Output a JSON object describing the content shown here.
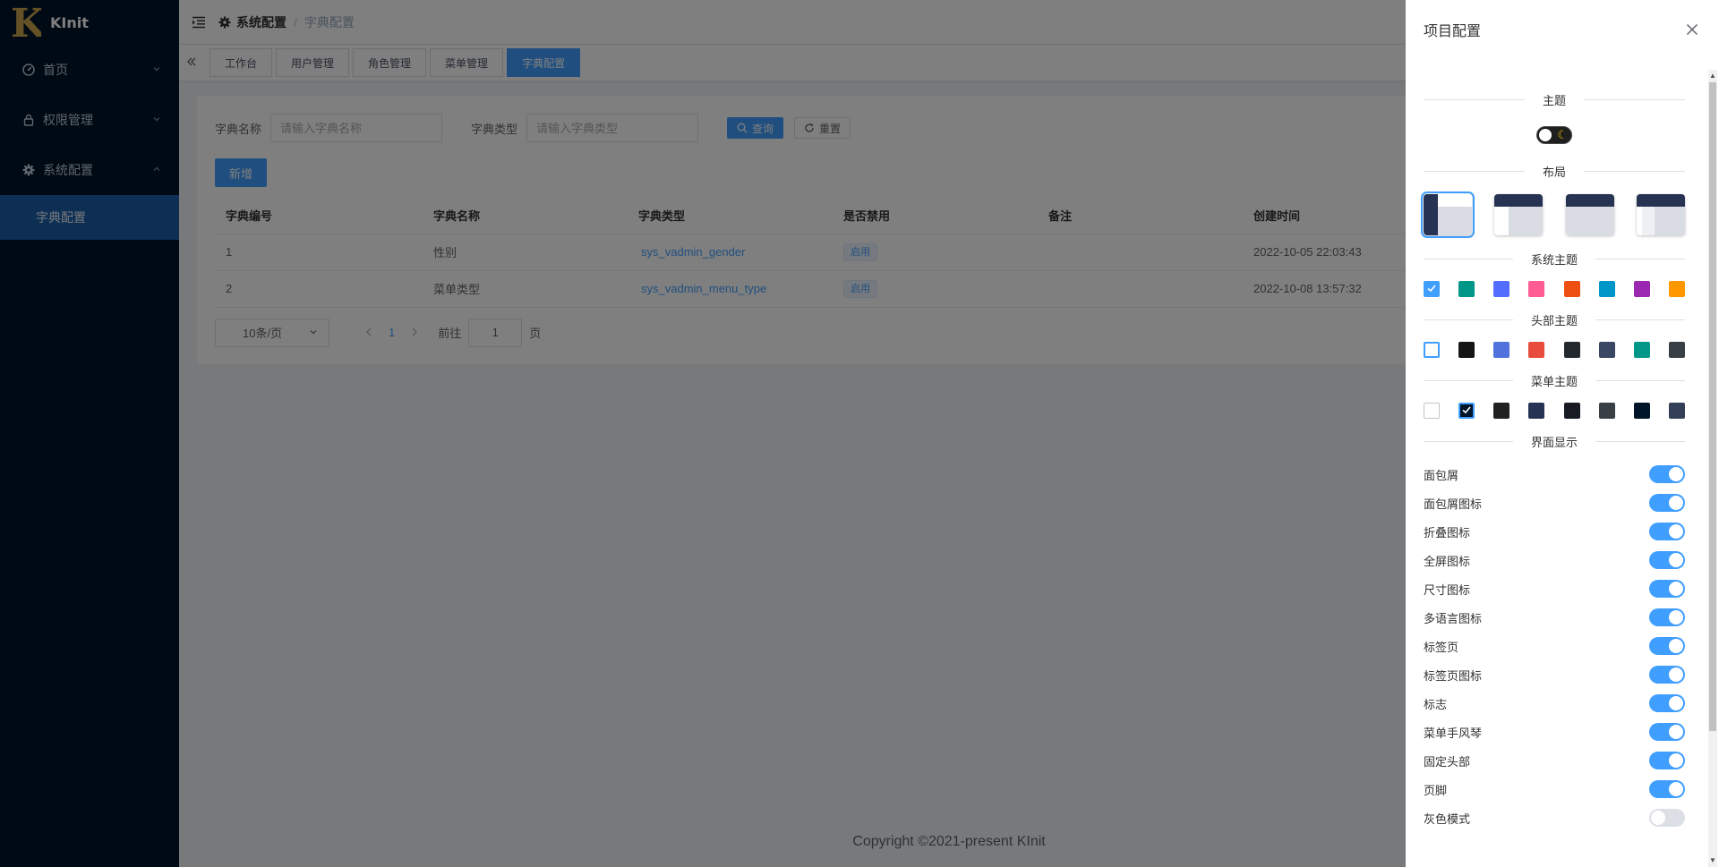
{
  "app": {
    "name": "KInit",
    "logo_letter": "K"
  },
  "sidebar": {
    "items": [
      {
        "label": "首页",
        "icon": "dashboard-icon"
      },
      {
        "label": "权限管理",
        "icon": "lock-icon"
      },
      {
        "label": "系统配置",
        "icon": "gear-icon",
        "expanded": true,
        "children": [
          {
            "label": "字典配置",
            "active": true
          }
        ]
      }
    ]
  },
  "header": {
    "breadcrumb": [
      "系统配置",
      "字典配置"
    ]
  },
  "tabs": [
    {
      "label": "工作台"
    },
    {
      "label": "用户管理"
    },
    {
      "label": "角色管理"
    },
    {
      "label": "菜单管理"
    },
    {
      "label": "字典配置",
      "active": true
    }
  ],
  "search": {
    "name_label": "字典名称",
    "name_placeholder": "请输入字典名称",
    "type_label": "字典类型",
    "type_placeholder": "请输入字典类型",
    "query_label": "查询",
    "reset_label": "重置",
    "add_label": "新增"
  },
  "table": {
    "columns": [
      "字典编号",
      "字典名称",
      "字典类型",
      "是否禁用",
      "备注",
      "创建时间"
    ],
    "rows": [
      {
        "id": "1",
        "name": "性别",
        "type": "sys_vadmin_gender",
        "status": "启用",
        "remark": "",
        "created": "2022-10-05 22:03:43"
      },
      {
        "id": "2",
        "name": "菜单类型",
        "type": "sys_vadmin_menu_type",
        "status": "启用",
        "remark": "",
        "created": "2022-10-08 13:57:32"
      }
    ]
  },
  "pagination": {
    "page_size": "10条/页",
    "current_page": "1",
    "goto_label": "前往",
    "goto_value": "1",
    "page_unit": "页"
  },
  "footer": {
    "copyright": "Copyright ©2021-present KInit"
  },
  "drawer": {
    "title": "项目配置",
    "sections": {
      "theme": "主题",
      "layout": "布局",
      "system_theme": "系统主题",
      "header_theme": "头部主题",
      "menu_theme": "菜单主题",
      "interface": "界面显示"
    },
    "system_colors": [
      "#409eff",
      "#009688",
      "#536dfe",
      "#ff5c93",
      "#ee4f12",
      "#0096c7",
      "#9c27b0",
      "#ff9800"
    ],
    "header_colors": [
      "#ffffff",
      "#151515",
      "#5172dc",
      "#e74c3c",
      "#24292e",
      "#394664",
      "#009688",
      "#383f45"
    ],
    "menu_colors": [
      "#ffffff",
      "#001529",
      "#212121",
      "#273352",
      "#191b24",
      "#383f45",
      "#001628",
      "#344058"
    ],
    "system_selected": 0,
    "header_selected": 0,
    "menu_selected": 1,
    "toggles": [
      {
        "label": "面包屑",
        "on": true
      },
      {
        "label": "面包屑图标",
        "on": true
      },
      {
        "label": "折叠图标",
        "on": true
      },
      {
        "label": "全屏图标",
        "on": true
      },
      {
        "label": "尺寸图标",
        "on": true
      },
      {
        "label": "多语言图标",
        "on": true
      },
      {
        "label": "标签页",
        "on": true
      },
      {
        "label": "标签页图标",
        "on": true
      },
      {
        "label": "标志",
        "on": true
      },
      {
        "label": "菜单手风琴",
        "on": true
      },
      {
        "label": "固定头部",
        "on": true
      },
      {
        "label": "页脚",
        "on": true
      },
      {
        "label": "灰色模式",
        "on": false
      }
    ]
  }
}
